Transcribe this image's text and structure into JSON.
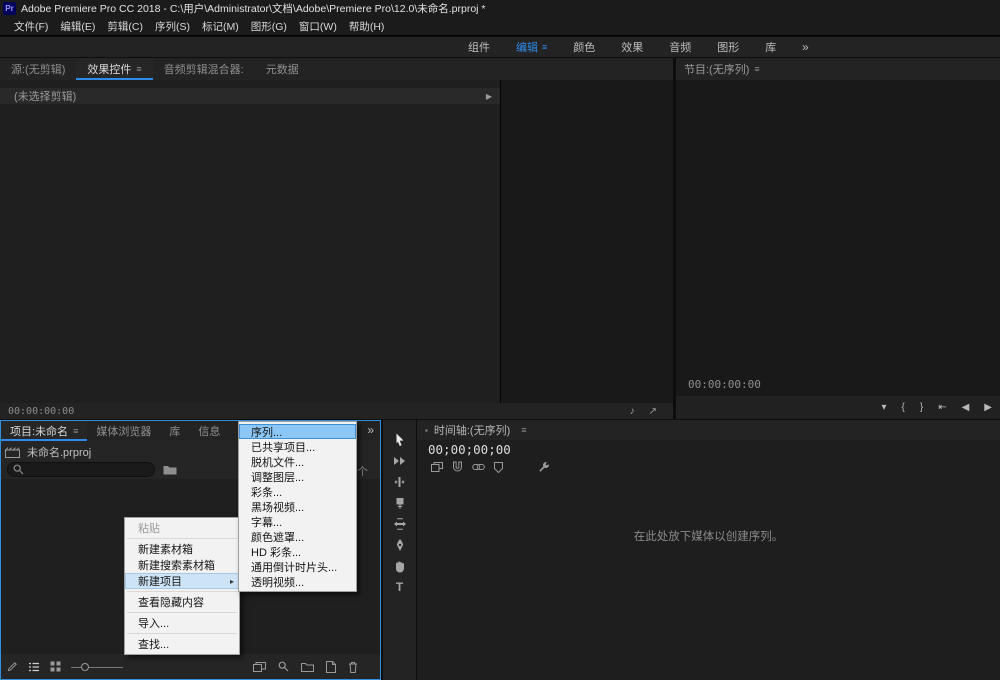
{
  "colors": {
    "accent": "#2d8ceb",
    "menu_highlight": "#8cc6f4",
    "submenu_open_highlight": "#cde4f7"
  },
  "title_bar": {
    "app_icon_label": "Pr",
    "title": "Adobe Premiere Pro CC 2018 - C:\\用户\\Administrator\\文档\\Adobe\\Premiere Pro\\12.0\\未命名.prproj *"
  },
  "menu_bar": {
    "items": [
      "文件(F)",
      "编辑(E)",
      "剪辑(C)",
      "序列(S)",
      "标记(M)",
      "图形(G)",
      "窗口(W)",
      "帮助(H)"
    ]
  },
  "workspace_bar": {
    "tabs": [
      "组件",
      "编辑",
      "颜色",
      "效果",
      "音频",
      "图形",
      "库"
    ],
    "active_tab": "编辑",
    "active_menu_icon": "≡",
    "overflow_icon": "»"
  },
  "source_panel": {
    "tabs": [
      "源:(无剪辑)",
      "效果控件",
      "音频剪辑混合器:",
      "元数据"
    ],
    "active_tab": "效果控件",
    "panel_menu_icon": "≡",
    "empty_text": "(未选择剪辑)",
    "timeline_arrow_icon": "▶",
    "timecode": "00:00:00:00",
    "footer_icons": {
      "audio_icon": "♪",
      "zoom_icon": "↗"
    }
  },
  "program_panel": {
    "title": "节目:(无序列)",
    "panel_menu_icon": "≡",
    "timecode": "00:00:00:00",
    "transport_icons": {
      "marker": "▾",
      "mark_in": "{",
      "mark_out": "}",
      "go_to_in": "⇤",
      "step_back": "◀",
      "play": "▶"
    }
  },
  "project_panel": {
    "tabs": [
      "项目:未命名",
      "媒体浏览器",
      "库",
      "信息"
    ],
    "active_tab": "项目:未命名",
    "panel_menu_icon": "≡",
    "overflow_icon": "»",
    "project_file": "未命名.prproj",
    "search_value": "",
    "item_count_text": "个项"
  },
  "context_menu": {
    "items": [
      {
        "label": "粘贴",
        "state": "disabled"
      },
      {
        "label": "新建素材箱",
        "state": "normal"
      },
      {
        "label": "新建搜索素材箱",
        "state": "normal"
      },
      {
        "label": "新建项目",
        "state": "open-submenu",
        "arrow_icon": "▸"
      },
      {
        "label": "查看隐藏内容",
        "state": "normal"
      },
      {
        "label": "导入...",
        "state": "normal"
      },
      {
        "label": "查找...",
        "state": "normal"
      }
    ]
  },
  "new_item_submenu": {
    "highlighted_item": "序列...",
    "items": [
      "序列...",
      "已共享项目...",
      "脱机文件...",
      "调整图层...",
      "彩条...",
      "黑场视频...",
      "字幕...",
      "颜色遮罩...",
      "HD 彩条...",
      "通用倒计时片头...",
      "透明视频..."
    ]
  },
  "tools_panel": {
    "tools": [
      "selection",
      "track-select",
      "ripple-edit",
      "razor",
      "slip",
      "pen",
      "hand",
      "type"
    ],
    "active_tool": "selection",
    "type_tool_label": "T"
  },
  "timeline_panel": {
    "panel_icon": "▪",
    "title": "时间轴:(无序列)",
    "panel_menu_icon": "≡",
    "timecode": "00;00;00;00",
    "drop_hint": "在此处放下媒体以创建序列。"
  }
}
